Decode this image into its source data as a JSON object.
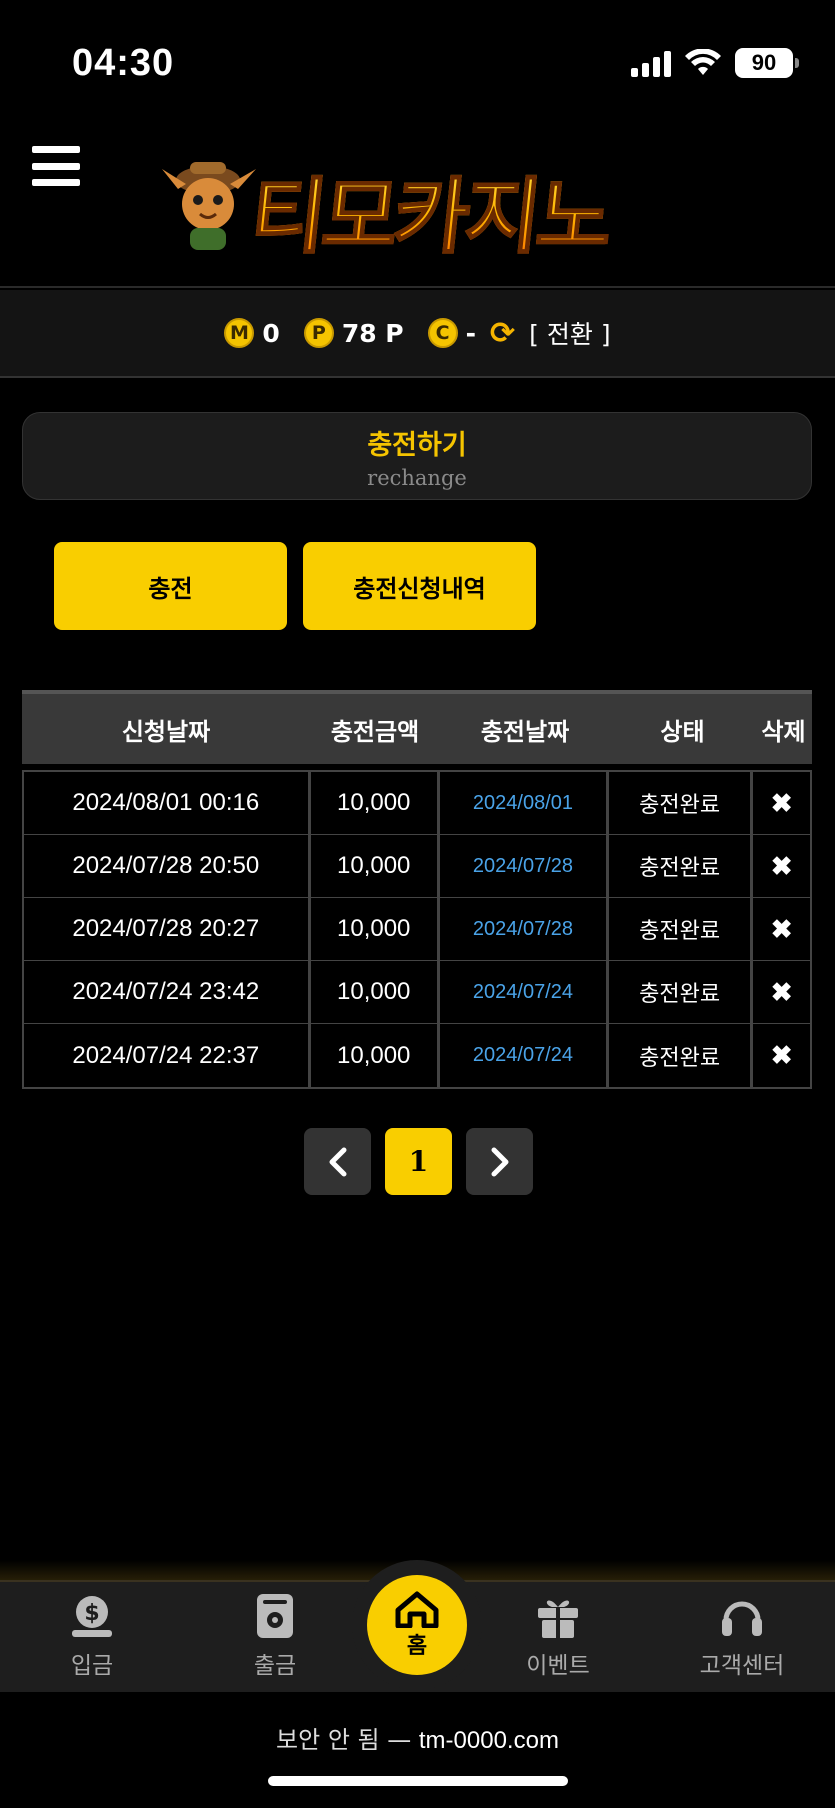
{
  "status_bar": {
    "time": "04:30",
    "battery": "90"
  },
  "header": {
    "logo_text": "티모카지노"
  },
  "points": {
    "money_icon": "M",
    "money_value": "0",
    "point_icon": "P",
    "point_value": "78 P",
    "casino_icon": "C",
    "casino_value": "-",
    "switch_label": "[ 전환 ]"
  },
  "page": {
    "title": "충전하기",
    "subtitle": "rechange"
  },
  "tabs": {
    "charge": "충전",
    "history": "충전신청내역"
  },
  "table": {
    "headers": [
      "신청날짜",
      "충전금액",
      "충전날짜",
      "상태",
      "삭제"
    ],
    "rows": [
      {
        "request_date": "2024/08/01 00:16",
        "amount": "10,000",
        "charge_date": "2024/08/01",
        "status": "충전완료"
      },
      {
        "request_date": "2024/07/28 20:50",
        "amount": "10,000",
        "charge_date": "2024/07/28",
        "status": "충전완료"
      },
      {
        "request_date": "2024/07/28 20:27",
        "amount": "10,000",
        "charge_date": "2024/07/28",
        "status": "충전완료"
      },
      {
        "request_date": "2024/07/24 23:42",
        "amount": "10,000",
        "charge_date": "2024/07/24",
        "status": "충전완료"
      },
      {
        "request_date": "2024/07/24 22:37",
        "amount": "10,000",
        "charge_date": "2024/07/24",
        "status": "충전완료"
      }
    ],
    "delete_symbol": "✖"
  },
  "pagination": {
    "prev": "‹",
    "current": "1",
    "next": "›"
  },
  "bottom_nav": {
    "deposit": "입금",
    "withdraw": "출금",
    "home": "홈",
    "event": "이벤트",
    "support": "고객센터"
  },
  "browser": {
    "security": "보안 안 됨 —",
    "url": "tm-0000.com"
  },
  "colors": {
    "accent": "#f9ce00",
    "link": "#4aa3e8",
    "background": "#000000"
  }
}
